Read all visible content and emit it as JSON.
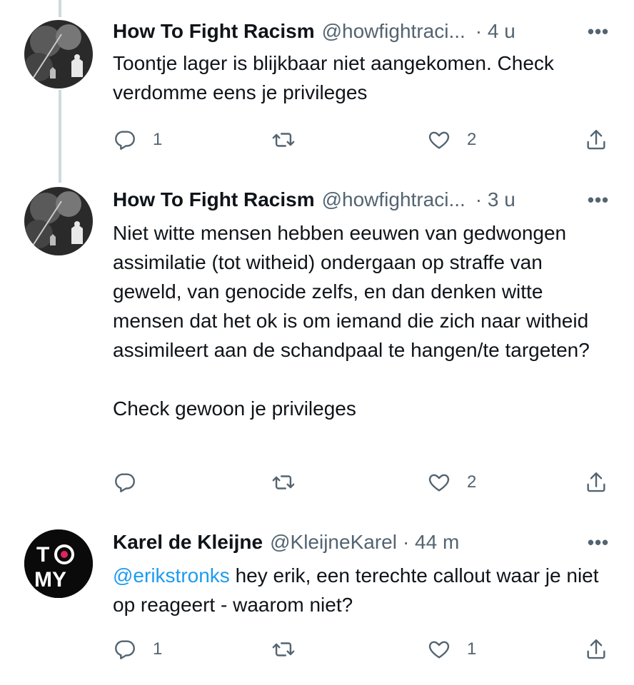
{
  "tweets": [
    {
      "name": "How To Fight Racism",
      "handle": "@howfightraci...",
      "time": "· 4 u",
      "more": "•••",
      "paragraphs": [
        "Toontje lager is blijkbaar niet aangekomen. Check verdomme eens je privileges"
      ],
      "reply_count": "1",
      "retweet_count": "",
      "like_count": "2"
    },
    {
      "name": "How To Fight Racism",
      "handle": "@howfightraci...",
      "time": "· 3 u",
      "more": "•••",
      "paragraphs": [
        "Niet witte mensen hebben eeuwen van gedwongen assimilatie (tot witheid) ondergaan op straffe van geweld, van genocide zelfs, en dan denken witte mensen dat het ok is om iemand die zich naar witheid assimileert aan de schandpaal te hangen/te targeten?",
        "Check gewoon je privileges"
      ],
      "reply_count": "",
      "retweet_count": "",
      "like_count": "2"
    },
    {
      "name": "Karel de Kleijne",
      "handle": "@KleijneKarel",
      "time": "· 44 m",
      "more": "•••",
      "mention": "@erikstronks",
      "text": " hey erik, een terechte callout waar je niet op reageert - waarom niet?",
      "reply_count": "1",
      "retweet_count": "",
      "like_count": "1",
      "avatar_text_top": "T",
      "avatar_text_bottom": "MY"
    }
  ],
  "icons": {
    "reply": "reply-icon",
    "retweet": "retweet-icon",
    "like": "heart-icon",
    "share": "share-icon"
  },
  "colors": {
    "text": "#0f1419",
    "secondary": "#536471",
    "link": "#1d9bf0",
    "thread_line": "#cfd9de"
  }
}
